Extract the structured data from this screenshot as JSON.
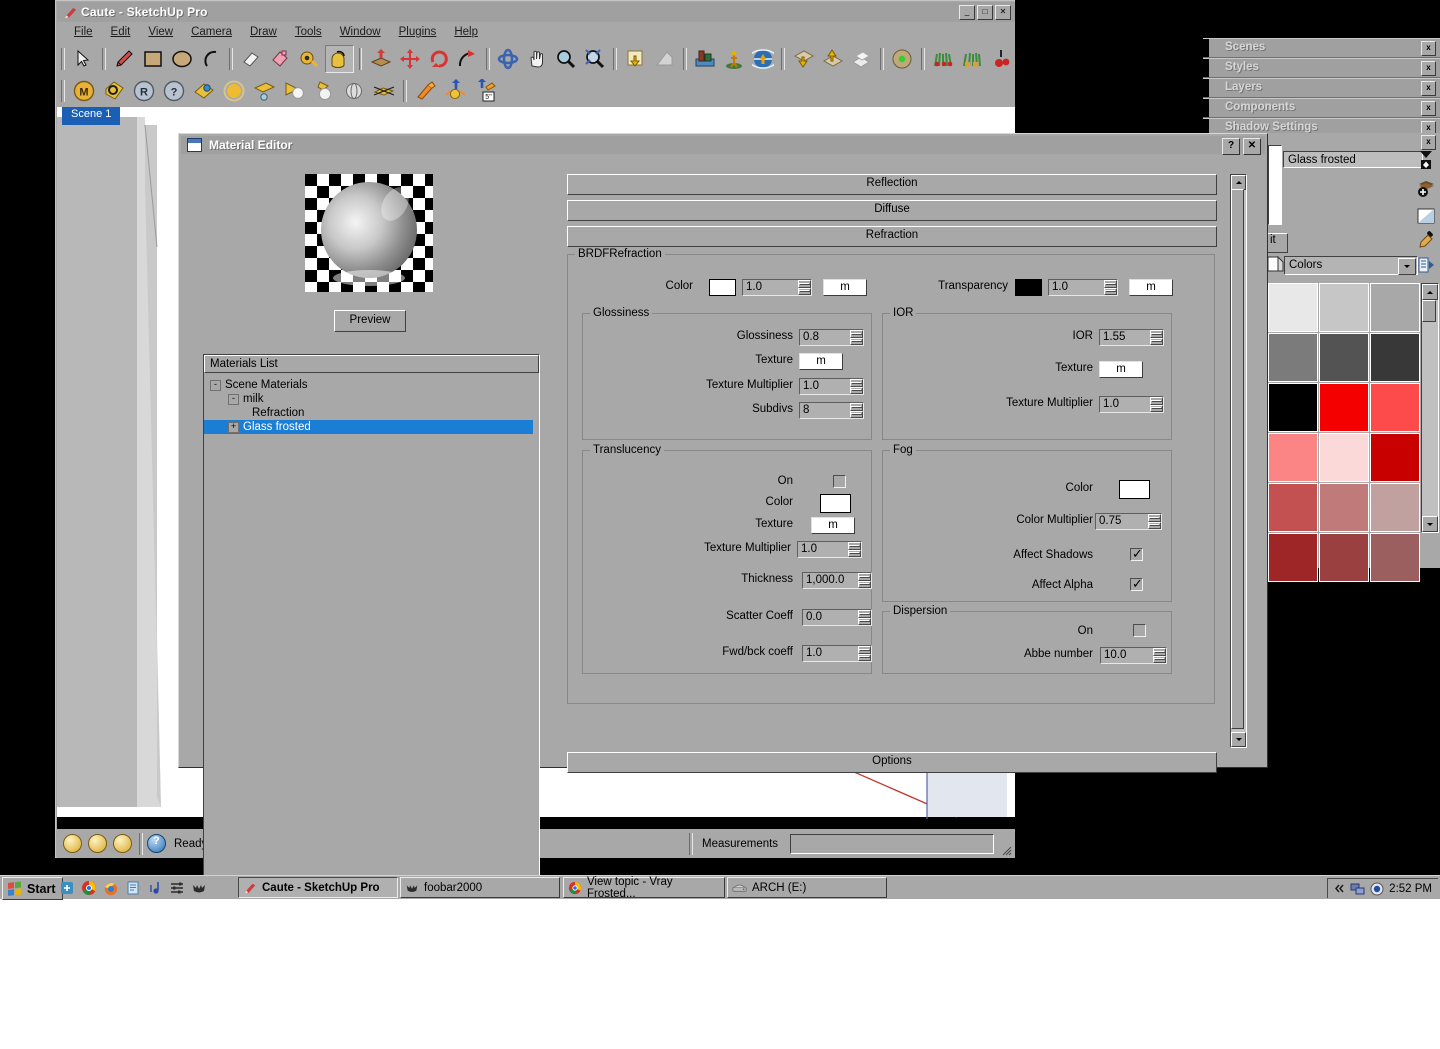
{
  "app": {
    "title": "Caute - SketchUp Pro",
    "window_buttons": [
      "_",
      "□",
      "✕"
    ],
    "menus": [
      "File",
      "Edit",
      "View",
      "Camera",
      "Draw",
      "Tools",
      "Window",
      "Plugins",
      "Help"
    ],
    "scene_tab": "Scene 1",
    "statusbar": {
      "ready": "Ready",
      "measurements_label": "Measurements",
      "measurements_value": ""
    },
    "toolbar1_icons": [
      "select-arrow-icon",
      "pencil-line-icon",
      "rectangle-icon",
      "circle-icon",
      "arc-icon",
      "eraser-icon",
      "paint-bucket-icon",
      "tape-measure-icon",
      "material-bucket-icon",
      "push-pull-icon",
      "move-icon",
      "rotate-icon",
      "follow-me-icon",
      "orbit-icon",
      "pan-icon",
      "zoom-icon",
      "zoom-extents-icon",
      "import-icon",
      "shadow-icon",
      "scene-icon",
      "person-scale-icon",
      "geo-location-icon",
      "layer-down-icon",
      "layer-up-icon",
      "solid-tools-icon",
      "render-sphere-icon",
      "plants-1-icon",
      "plants-2-icon",
      "plants-3-icon"
    ],
    "toolbar2_icons": [
      "vray-material-icon",
      "vray-options-icon",
      "vray-render-icon",
      "vray-help-icon",
      "vray-light-material-icon",
      "omni-light-icon",
      "rect-light-icon",
      "spot-light-icon",
      "ies-light-icon",
      "sphere-light-icon",
      "mesh-light-icon",
      "dynamic-comp-icon",
      "interact-icon",
      "dim-tool-icon"
    ]
  },
  "trays": {
    "items": [
      {
        "label": "Scenes",
        "close": "x"
      },
      {
        "label": "Styles",
        "close": "x"
      },
      {
        "label": "Layers",
        "close": "x"
      },
      {
        "label": "Components",
        "close": "x"
      },
      {
        "label": "Shadow Settings",
        "close": "x"
      }
    ],
    "materials_panel": {
      "close": "x",
      "material_name": "Glass frosted",
      "tab_label": "it",
      "category": "Colors",
      "buttons": [
        "select-material-icon",
        "create-material-icon",
        "set-default-icon",
        "eyedropper-icon",
        "list-options-icon"
      ],
      "swatches": [
        "#e8e8e8",
        "#c6c6c6",
        "#a8a8a8",
        "#7b7b7b",
        "#535353",
        "#383838",
        "#000000",
        "#f50000",
        "#fd4a4a",
        "#fb8585",
        "#fbd9d9",
        "#c90000",
        "#c35151",
        "#c07a7a",
        "#c1a0a0",
        "#9e2626",
        "#9a4040",
        "#9c5f5f"
      ]
    }
  },
  "material_editor": {
    "title": "Material Editor",
    "help_button": "?",
    "close_button": "✕",
    "preview_button": "Preview",
    "materials_list_header": "Materials List",
    "tree": [
      {
        "label": "Scene Materials",
        "indent": 0,
        "toggle": "-",
        "selected": false
      },
      {
        "label": "milk",
        "indent": 1,
        "toggle": "-",
        "selected": false
      },
      {
        "label": "Refraction",
        "indent": 2,
        "toggle": "",
        "selected": false
      },
      {
        "label": "Glass frosted",
        "indent": 1,
        "toggle": "+",
        "selected": true
      }
    ],
    "rollouts": [
      "Reflection",
      "Diffuse",
      "Refraction"
    ],
    "options_bar": "Options",
    "brdf_group": {
      "title": "BRDFRefraction",
      "color_label": "Color",
      "color_swatch": "#ffffff",
      "color_value": "1.0",
      "color_texture_btn": "m",
      "transparency_label": "Transparency",
      "transparency_swatch": "#000000",
      "transparency_value": "1.0",
      "transparency_texture_btn": "m"
    },
    "glossiness_group": {
      "title": "Glossiness",
      "rows": [
        {
          "label": "Glossiness",
          "value": "0.8",
          "type": "spin"
        },
        {
          "label": "Texture",
          "value": "m",
          "type": "button"
        },
        {
          "label": "Texture Multiplier",
          "value": "1.0",
          "type": "spin"
        },
        {
          "label": "Subdivs",
          "value": "8",
          "type": "spin"
        }
      ]
    },
    "ior_group": {
      "title": "IOR",
      "rows": [
        {
          "label": "IOR",
          "value": "1.55",
          "type": "spin"
        },
        {
          "label": "Texture",
          "value": "m",
          "type": "button"
        },
        {
          "label": "Texture Multiplier",
          "value": "1.0",
          "type": "spin"
        }
      ]
    },
    "translucency_group": {
      "title": "Translucency",
      "on_label": "On",
      "on_checked": false,
      "color_label": "Color",
      "color_swatch": "#ffffff",
      "texture_label": "Texture",
      "texture_btn": "m",
      "rows": [
        {
          "label": "Texture Multiplier",
          "value": "1.0"
        },
        {
          "label": "Thickness",
          "value": "1,000.0"
        },
        {
          "label": "Scatter Coeff",
          "value": "0.0"
        },
        {
          "label": "Fwd/bck coeff",
          "value": "1.0"
        }
      ]
    },
    "fog_group": {
      "title": "Fog",
      "color_label": "Color",
      "color_swatch": "#ffffff",
      "color_multiplier_label": "Color Multiplier",
      "color_multiplier_value": "0.75",
      "affect_shadows_label": "Affect Shadows",
      "affect_shadows_checked": true,
      "affect_alpha_label": "Affect Alpha",
      "affect_alpha_checked": true,
      "check_mark": "✓"
    },
    "dispersion_group": {
      "title": "Dispersion",
      "on_label": "On",
      "on_checked": false,
      "abbe_label": "Abbe number",
      "abbe_value": "10.0"
    }
  },
  "taskbar": {
    "start_label": "Start",
    "quick_launch": [
      "show-desktop-icon",
      "chrome-icon",
      "firefox-icon",
      "notepad-icon",
      "foobar-icon",
      "equalizer-icon",
      "bat-icon"
    ],
    "tasks": [
      {
        "label": "Caute - SketchUp Pro",
        "icon": "sketchup-icon",
        "selected": true
      },
      {
        "label": "foobar2000",
        "icon": "bat-icon",
        "selected": false
      },
      {
        "label": "View topic - Vray Frosted...",
        "icon": "chrome-icon",
        "selected": false
      },
      {
        "label": "ARCH (E:)",
        "icon": "drive-icon",
        "selected": false
      }
    ],
    "tray_icons": [
      "chevron-left-icon",
      "network-icon",
      "volume-icon"
    ],
    "clock": "2:52 PM"
  }
}
